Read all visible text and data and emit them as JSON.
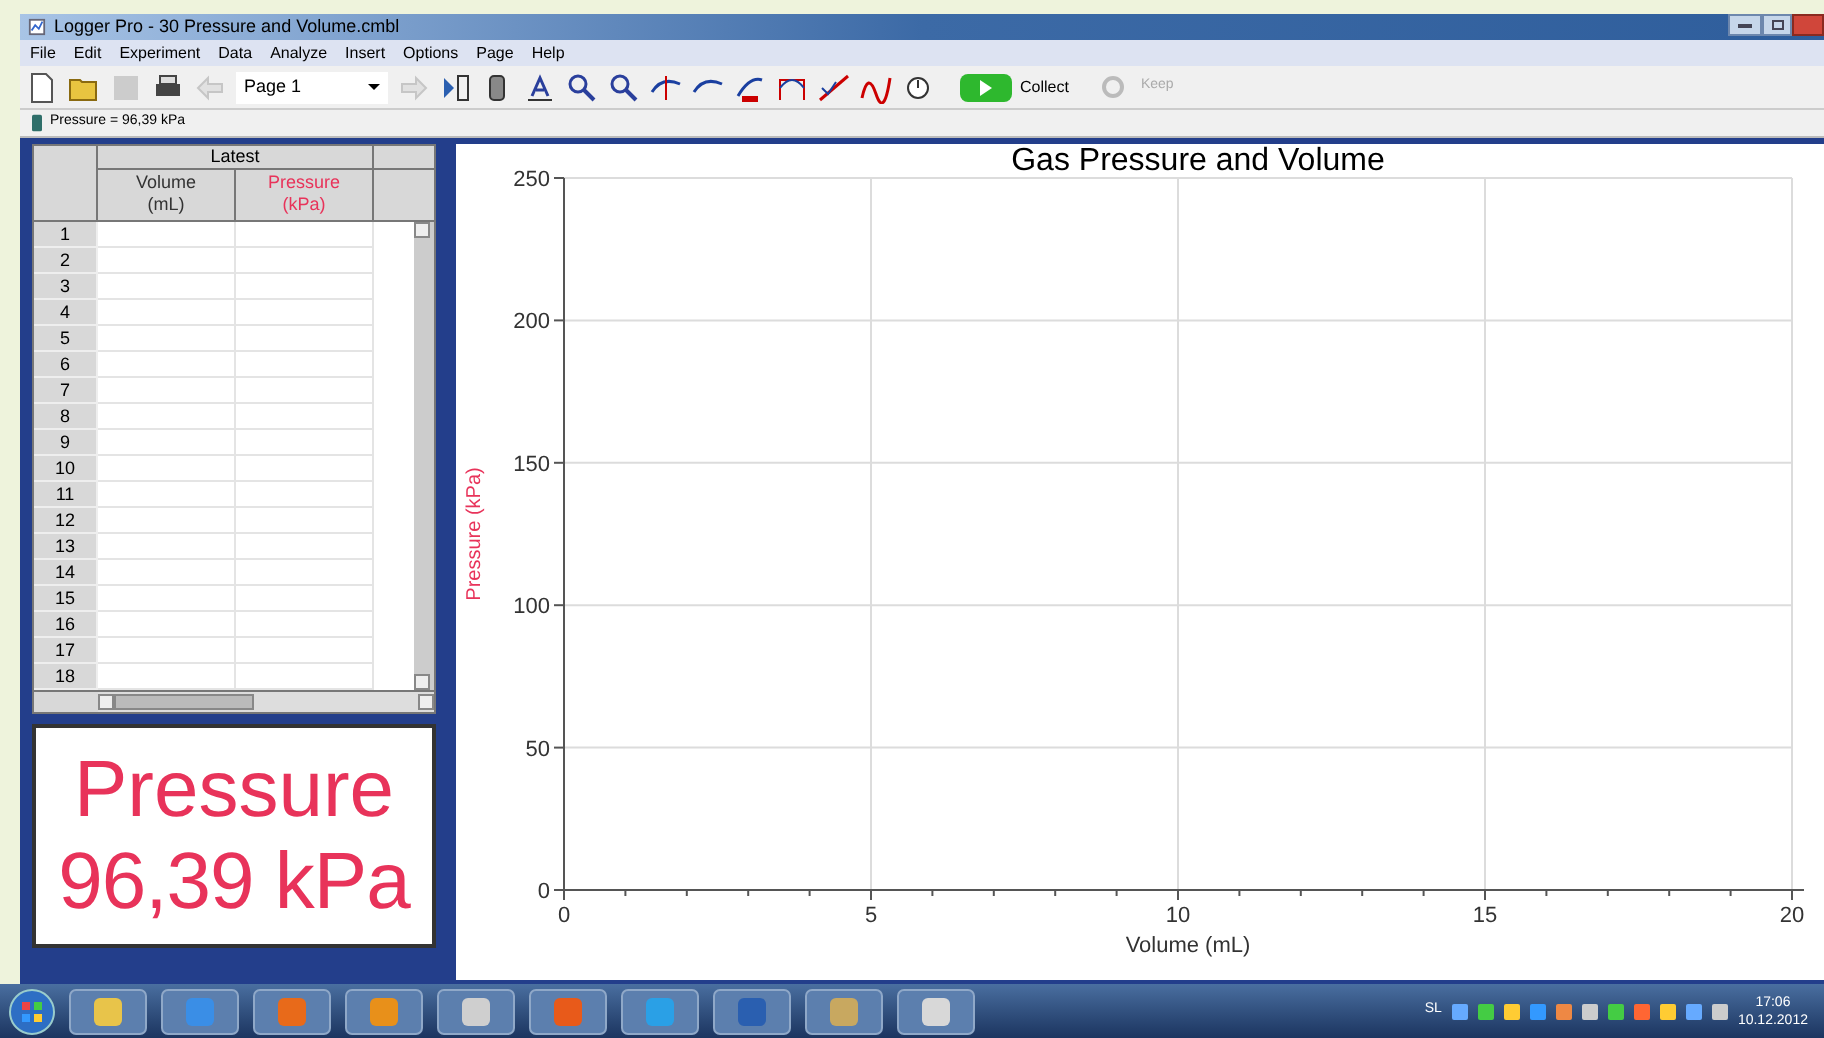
{
  "window": {
    "title": "Logger Pro - 30 Pressure and Volume.cmbl"
  },
  "menu": [
    "File",
    "Edit",
    "Experiment",
    "Data",
    "Analyze",
    "Insert",
    "Options",
    "Page",
    "Help"
  ],
  "toolbar": {
    "page_select": {
      "value": "Page 1"
    },
    "collect": {
      "label": "Collect",
      "disabled": false
    },
    "keep": {
      "label": "Keep",
      "disabled": true
    }
  },
  "sensor_bar": {
    "reading": "Pressure = 96,39 kPa"
  },
  "table": {
    "group_header": "Latest",
    "columns": [
      {
        "name": "Volume",
        "unit": "(mL)",
        "color": "#333333"
      },
      {
        "name": "Pressure",
        "unit": "(kPa)",
        "color": "#e8335a"
      }
    ],
    "rows": [
      "1",
      "2",
      "3",
      "4",
      "5",
      "6",
      "7",
      "8",
      "9",
      "10",
      "11",
      "12",
      "13",
      "14",
      "15",
      "16",
      "17",
      "18"
    ]
  },
  "meter": {
    "label": "Pressure",
    "value": "96,39 kPa"
  },
  "graph": {
    "chart_data": {
      "type": "scatter",
      "title": "Gas Pressure and Volume",
      "xlabel": "Volume (mL)",
      "ylabel": "Pressure (kPa)",
      "xlim": [
        0,
        20
      ],
      "ylim": [
        0,
        250
      ],
      "xticks": [
        0,
        5,
        10,
        15,
        20
      ],
      "yticks": [
        0,
        50,
        100,
        150,
        200,
        250
      ],
      "grid": true
    }
  },
  "taskbar": {
    "tray_label": "SL",
    "time": "17:06",
    "date": "10.12.2012"
  }
}
